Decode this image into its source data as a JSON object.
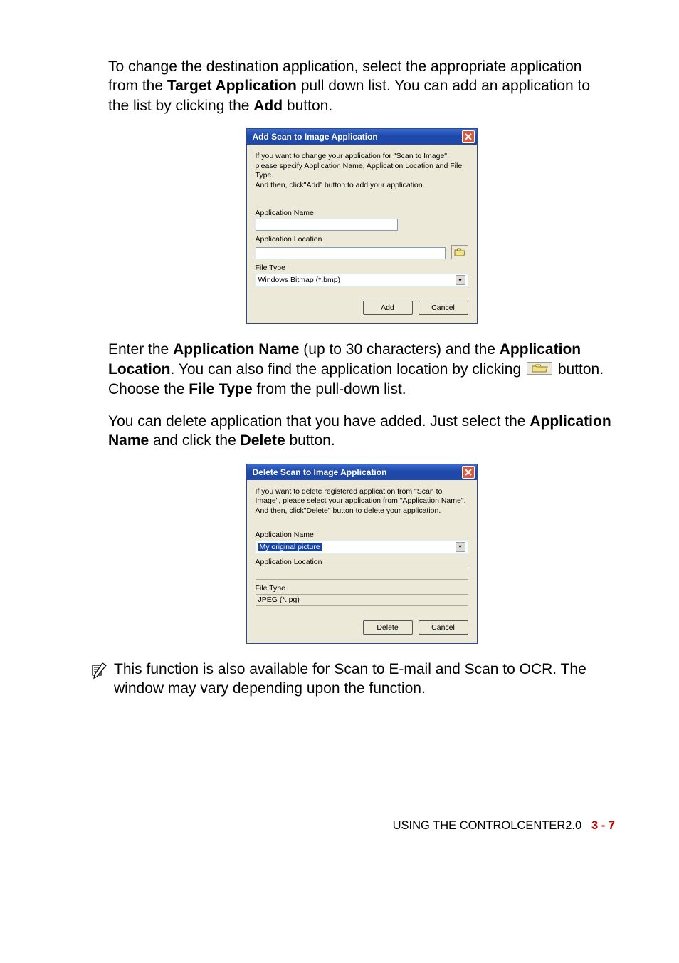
{
  "para1": {
    "t1": "To change the destination application, select the appropriate application from the ",
    "b1": "Target Application",
    "t2": " pull down list. You can add an application to the list by clicking the ",
    "b2": "Add",
    "t3": " button."
  },
  "dlg_add": {
    "title": "Add Scan to Image Application",
    "intro": "If you want to change your application for \"Scan to Image\", please specify Application Name, Application Location and File Type.\nAnd then, click\"Add\" button to add your application.",
    "lbl_name": "Application Name",
    "val_name": "",
    "lbl_loc": "Application Location",
    "val_loc": "",
    "lbl_type": "File Type",
    "val_type": "Windows Bitmap (*.bmp)",
    "btn_primary": "Add",
    "btn_cancel": "Cancel"
  },
  "para2": {
    "t1": "Enter the ",
    "b1": "Application Name",
    "t2": " (up to 30 characters) and the ",
    "b2": "Application Location",
    "t3": ". You can also find the application location by clicking ",
    "t4": " button. Choose the ",
    "b3": "File Type",
    "t5": " from the pull-down list."
  },
  "para3": {
    "t1": "You can delete application that you have added. Just select the ",
    "b1": "Application Name",
    "t2": " and click the ",
    "b2": "Delete",
    "t3": " button."
  },
  "dlg_del": {
    "title": "Delete Scan to Image Application",
    "intro": "If you want to delete registered application from \"Scan to Image\", please select your application from \"Application Name\".\nAnd then, click\"Delete\" button to delete your application.",
    "lbl_name": "Application Name",
    "val_name": "My original picture",
    "lbl_loc": "Application Location",
    "val_loc": "",
    "lbl_type": "File Type",
    "val_type": "JPEG (*.jpg)",
    "btn_primary": "Delete",
    "btn_cancel": "Cancel"
  },
  "note": "This function is also available for Scan to E-mail and Scan to OCR. The window may vary depending upon the function.",
  "footer": {
    "text": "USING THE CONTROLCENTER2.0",
    "page": "3 - 7"
  }
}
